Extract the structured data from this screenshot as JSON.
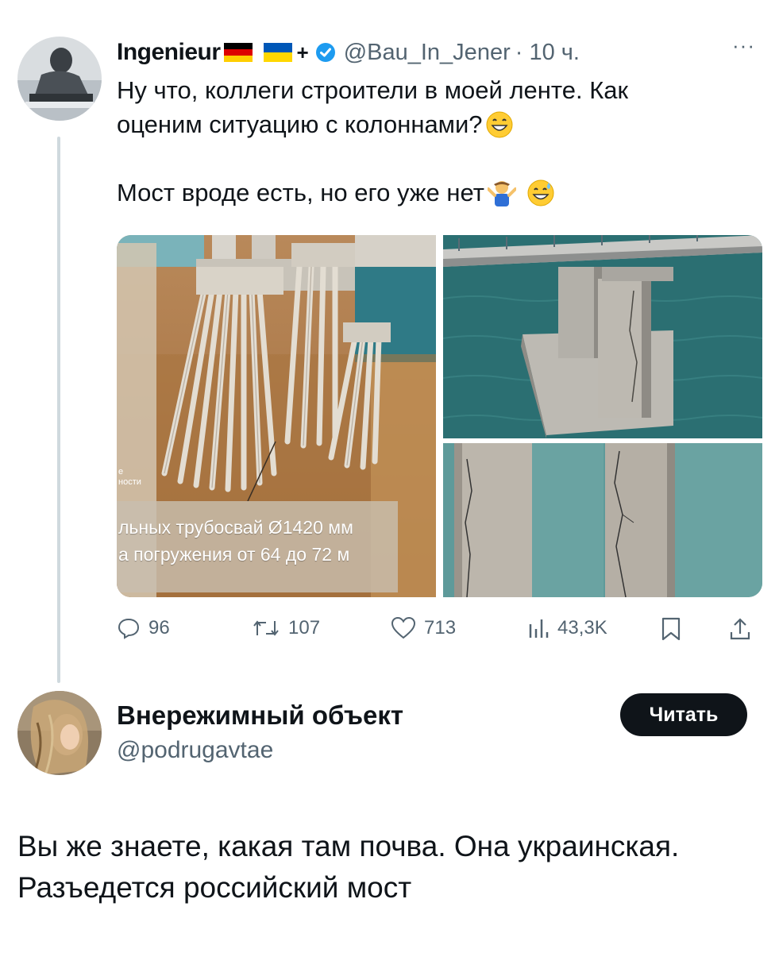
{
  "tweet": {
    "author_name": "Ingenieur",
    "handle": "@Bau_In_Jener",
    "time": "· 10 ч.",
    "more": "···",
    "text_line1": "Ну что, коллеги строители в моей ленте. Как",
    "text_line2": "оценим ситуацию с колоннами?",
    "text_line3": "Мост вроде есть, но его уже нет",
    "image_caption_line1": "льных трубосвай  Ø1420 мм",
    "image_caption_line2": "а погружения от 64 до 72 м",
    "image_caption_small1": "е",
    "image_caption_small2": "ности",
    "stats": {
      "replies": "96",
      "retweets": "107",
      "likes": "713",
      "views": "43,3K"
    },
    "colors": {
      "verified": "#1d9bf0",
      "text": "#0f1419",
      "secondary": "#536471"
    }
  },
  "reply": {
    "author_name": "Внережимный объект",
    "handle": "@podrugavtae",
    "follow_label": "Читать",
    "text_line1": "Вы же знаете, какая там почва. Она украинская.",
    "text_line2": "Разъедется российский мост"
  }
}
